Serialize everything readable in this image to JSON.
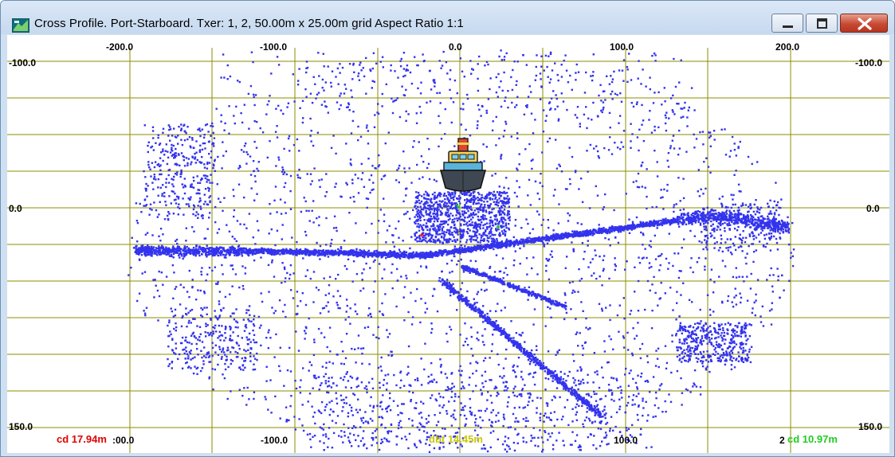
{
  "window": {
    "title": "Cross Profile. Port-Starboard. Txer: 1, 2, 50.00m x 25.00m grid Aspect Ratio 1:1",
    "icon": "sonar-app-icon",
    "controls": {
      "minimize_icon": "minimize-icon",
      "maximize_icon": "maximize-icon",
      "close_icon": "close-icon"
    }
  },
  "axes": {
    "x_top_labels": [
      "-200.0",
      "-100.0",
      "0.0",
      "100.0",
      "200.0"
    ],
    "x_bottom_labels": [
      ":00.0",
      "-100.0",
      "100.0",
      "2"
    ],
    "y_left_labels": [
      "-100.0",
      "0.0",
      "150.0"
    ],
    "y_right_labels": [
      "-100.0",
      "0.0",
      "150.0"
    ],
    "grid_color": "#8c8c00"
  },
  "readouts": {
    "port_cd": "cd 17.94m",
    "dbt": "dbt 14.45m",
    "starboard_cd": "cd 10.97m",
    "port_color": "#e00000",
    "dbt_color": "#c8c800",
    "starboard_color": "#22cc22"
  },
  "markers": {
    "port": "+",
    "center": "↕",
    "starboard": "+",
    "nadir": "v"
  },
  "vessel": {
    "icon": "ship-icon"
  },
  "chart_data": {
    "type": "scatter",
    "xlim": [
      -200,
      200
    ],
    "ylim": [
      -100,
      150
    ],
    "grid": true,
    "point_color": "#3333ee"
  }
}
